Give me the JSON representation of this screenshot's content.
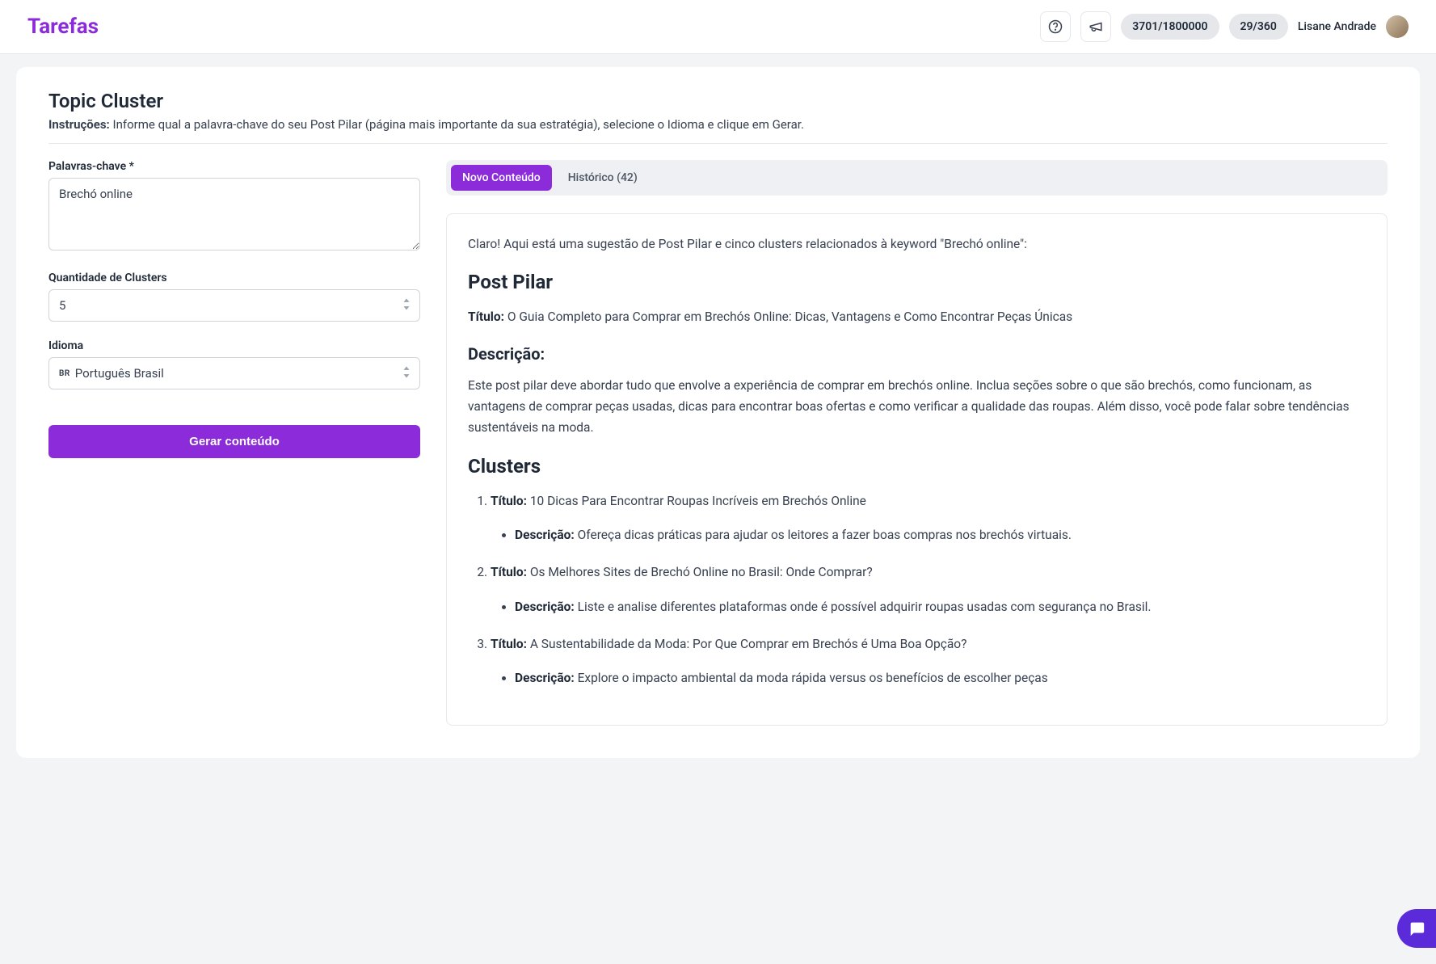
{
  "header": {
    "logo": "Tarefas",
    "counter1": "3701/1800000",
    "counter2": "29/360",
    "user_name": "Lisane Andrade"
  },
  "page": {
    "title": "Topic Cluster",
    "instructions_label": "Instruções:",
    "instructions_text": "Informe qual a palavra-chave do seu Post Pilar (página mais importante da sua estratégia), selecione o Idioma e clique em Gerar."
  },
  "form": {
    "keywords_label": "Palavras-chave *",
    "keywords_value": "Brechó online",
    "clusters_label": "Quantidade de Clusters",
    "clusters_value": "5",
    "language_label": "Idioma",
    "language_prefix": "BR",
    "language_value": "Português Brasil",
    "generate_label": "Gerar conteúdo"
  },
  "tabs": {
    "new_content": "Novo Conteúdo",
    "history": "Histórico (42)"
  },
  "output": {
    "intro": "Claro! Aqui está uma sugestão de Post Pilar e cinco clusters relacionados à keyword \"Brechó online\":",
    "post_pilar_heading": "Post Pilar",
    "titulo_label": "Título:",
    "post_pilar_titulo": "O Guia Completo para Comprar em Brechós Online: Dicas, Vantagens e Como Encontrar Peças Únicas",
    "descricao_heading": "Descrição:",
    "descricao_label": "Descrição:",
    "post_pilar_descricao": "Este post pilar deve abordar tudo que envolve a experiência de comprar em brechós online. Inclua seções sobre o que são brechós, como funcionam, as vantagens de comprar peças usadas, dicas para encontrar boas ofertas e como verificar a qualidade das roupas. Além disso, você pode falar sobre tendências sustentáveis na moda.",
    "clusters_heading": "Clusters",
    "clusters": [
      {
        "titulo": "10 Dicas Para Encontrar Roupas Incríveis em Brechós Online",
        "descricao": "Ofereça dicas práticas para ajudar os leitores a fazer boas compras nos brechós virtuais."
      },
      {
        "titulo": "Os Melhores Sites de Brechó Online no Brasil: Onde Comprar?",
        "descricao": "Liste e analise diferentes plataformas onde é possível adquirir roupas usadas com segurança no Brasil."
      },
      {
        "titulo": "A Sustentabilidade da Moda: Por Que Comprar em Brechós é Uma Boa Opção?",
        "descricao": "Explore o impacto ambiental da moda rápida versus os benefícios de escolher peças"
      }
    ]
  }
}
